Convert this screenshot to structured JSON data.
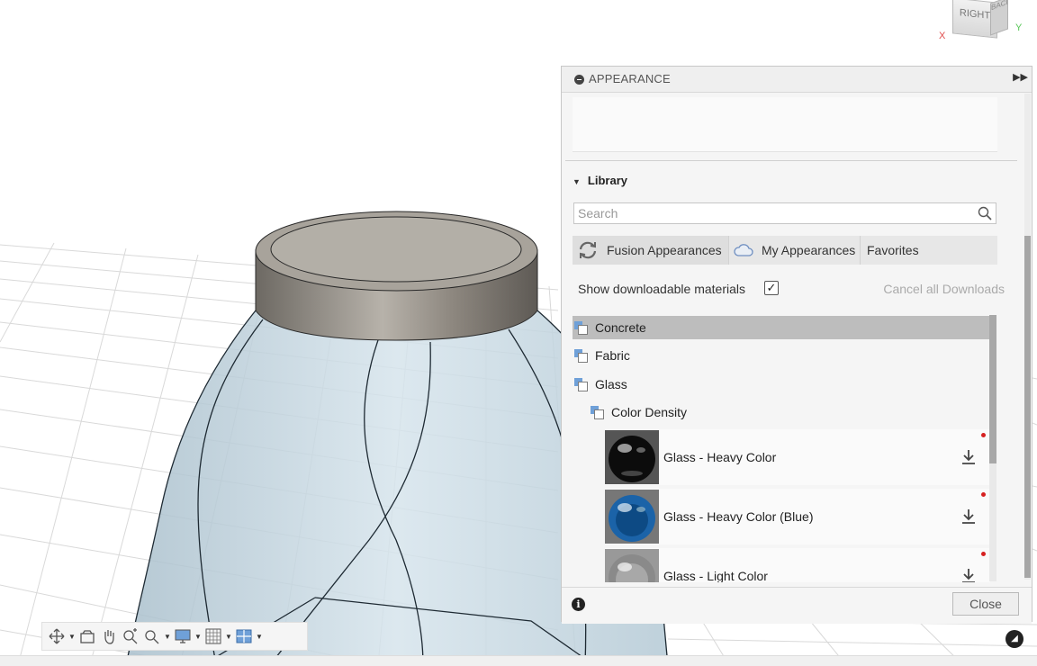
{
  "viewcube": {
    "face_label": "RIGHT",
    "side_label": "BACK",
    "axis_x": "X",
    "axis_y": "Y"
  },
  "panel": {
    "title": "APPEARANCE",
    "library_label": "Library",
    "search": {
      "placeholder": "Search",
      "value": ""
    },
    "tabs": [
      {
        "label": "Fusion Appearances"
      },
      {
        "label": "My Appearances"
      },
      {
        "label": "Favorites"
      }
    ],
    "show_downloadable_label": "Show downloadable materials",
    "show_downloadable_checked": "✓",
    "cancel_downloads_label": "Cancel all Downloads",
    "tree": [
      {
        "label": "Concrete"
      },
      {
        "label": "Fabric"
      },
      {
        "label": "Glass"
      },
      {
        "label": "Color Density"
      }
    ],
    "materials": [
      {
        "name": "Glass - Heavy Color",
        "color": "#111111"
      },
      {
        "name": "Glass - Heavy Color (Blue)",
        "color": "#1f6fb5"
      },
      {
        "name": "Glass - Light Color",
        "color": "#8c8c8c"
      }
    ],
    "close_label": "Close"
  },
  "nav_toolbar": {
    "icons": [
      "orbit-icon",
      "look-at-icon",
      "pan-icon",
      "zoom-icon",
      "fit-icon",
      "display-settings-icon",
      "grid-settings-icon",
      "viewports-icon"
    ]
  },
  "colors": {
    "accent": "#6fa0d8",
    "download_indicator": "#d62020",
    "glass_body": "#c9dbe6",
    "cap": "#8b857c"
  }
}
